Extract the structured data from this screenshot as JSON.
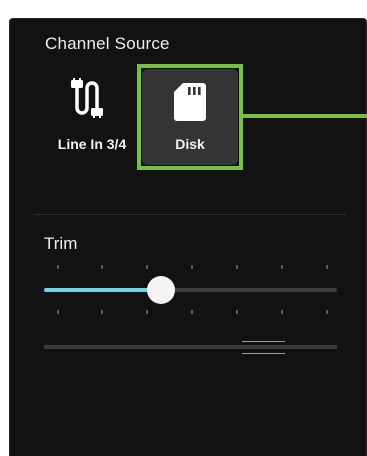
{
  "channel_source": {
    "title": "Channel Source",
    "options": [
      {
        "label": "Line In 3/4",
        "icon": "cable-icon",
        "selected": false
      },
      {
        "label": "Disk",
        "icon": "sd-card-icon",
        "selected": true
      }
    ]
  },
  "trim": {
    "label": "Trim",
    "level": 0.4
  },
  "colors": {
    "panel": "#121212",
    "highlight": "#77c043",
    "slider_fill": "#6fd3ea",
    "selected_bg": "#343434"
  }
}
